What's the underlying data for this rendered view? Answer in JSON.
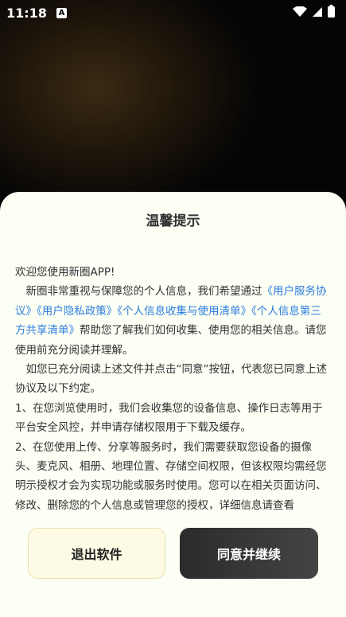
{
  "status_bar": {
    "time": "11:18",
    "notif_letter": "A",
    "icons": [
      "wifi-icon",
      "signal-icon",
      "battery-icon"
    ]
  },
  "dialog": {
    "title": "温馨提示",
    "greeting": "欢迎您使用新圈APP!",
    "p1_pre": "新圈非常重视与保障您的个人信息，我们希望通过",
    "link_service": "《用户服务协议》",
    "link_privacy": "《用户隐私政策》",
    "link_collect": "《个人信息收集与使用清单》",
    "link_share": "《个人信息第三方共享清单》",
    "p1_post": "帮助您了解我们如何收集、使用您的相关信息。请您使用前充分阅读并理解。",
    "p2": "如您已充分阅读上述文件并点击“同意”按钮，代表您已同意上述协议及以下约定。",
    "p3": "1、在您浏览使用时，我们会收集您的设备信息、操作日志等用于平台安全风控，并申请存储权限用于下载及缓存。",
    "p4": "2、在您使用上传、分享等服务时，我们需要获取您设备的摄像头、麦克风、相册、地理位置、存储空间权限，但该权限均需经您明示授权才会为实现功能或服务时使用。您可以在相关页面访问、修改、删除您的个人信息或管理您的授权，详细信息请查看",
    "exit_label": "退出软件",
    "agree_label": "同意并继续"
  },
  "colors": {
    "link": "#2f7ddf",
    "sheet_bg": "#fbfff4",
    "exit_bg": "#fefbe4",
    "agree_bg": "#333333"
  }
}
